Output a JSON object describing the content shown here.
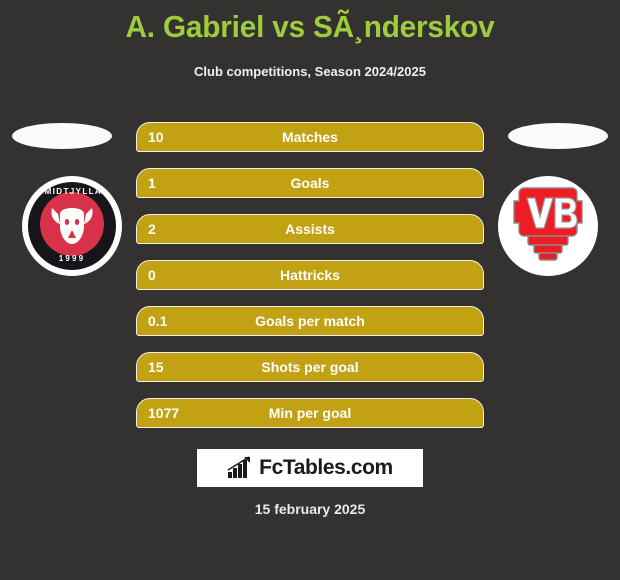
{
  "header": {
    "title": "A. Gabriel vs SÃ¸nderskov",
    "subtitle": "Club competitions, Season 2024/2025"
  },
  "colors": {
    "background": "#333230",
    "title_green": "#9fcc3b",
    "bar_gold": "#c2a212",
    "bar_border": "#f2efe2",
    "text_white": "#ffffff",
    "fcm_red": "#d8314a",
    "fcm_black": "#16161a",
    "vb_red": "#ee1c25"
  },
  "teams": {
    "left": {
      "name": "FC Midtjylland",
      "crest_icon": "fc-midtjylland-crest-icon",
      "crest_text_top": "FC MIDTJYLLAND",
      "crest_text_bottom": "1999"
    },
    "right": {
      "name": "Vejle Boldklub",
      "crest_icon": "vejle-boldklub-crest-icon",
      "crest_text": "VB"
    }
  },
  "stats": [
    {
      "label": "Matches",
      "value": "10"
    },
    {
      "label": "Goals",
      "value": "1"
    },
    {
      "label": "Assists",
      "value": "2"
    },
    {
      "label": "Hattricks",
      "value": "0"
    },
    {
      "label": "Goals per match",
      "value": "0.1"
    },
    {
      "label": "Shots per goal",
      "value": "15"
    },
    {
      "label": "Min per goal",
      "value": "1077"
    }
  ],
  "footer": {
    "brand": "FcTables.com",
    "brand_icon": "bar-chart-growth-icon",
    "date": "15 february 2025"
  },
  "chart_data": {
    "type": "bar",
    "title": "A. Gabriel vs SÃ¸nderskov",
    "subtitle": "Club competitions, Season 2024/2025",
    "categories": [
      "Matches",
      "Goals",
      "Assists",
      "Hattricks",
      "Goals per match",
      "Shots per goal",
      "Min per goal"
    ],
    "values": [
      10,
      1,
      2,
      0,
      0.1,
      15,
      1077
    ],
    "value_labels": [
      "10",
      "1",
      "2",
      "0",
      "0.1",
      "15",
      "1077"
    ],
    "xlabel": "",
    "ylabel": "",
    "grid": false,
    "legend": "none",
    "orientation": "horizontal",
    "note": "All bars rendered at full width regardless of value"
  }
}
